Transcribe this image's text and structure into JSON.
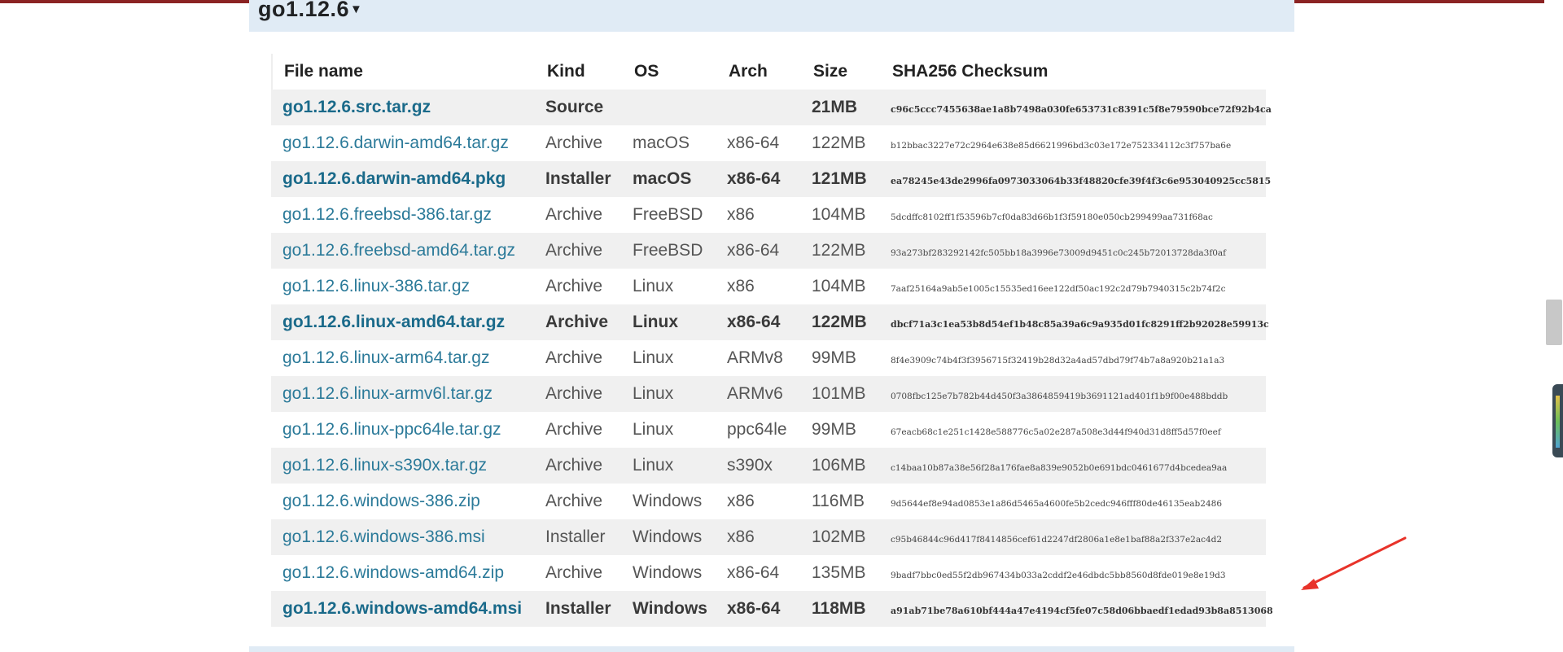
{
  "release": {
    "title": "go1.12.6",
    "caret": "▼"
  },
  "table": {
    "headers": {
      "file_name": "File name",
      "kind": "Kind",
      "os": "OS",
      "arch": "Arch",
      "size": "Size",
      "checksum": "SHA256 Checksum"
    },
    "rows": [
      {
        "file": "go1.12.6.src.tar.gz",
        "kind": "Source",
        "os": "",
        "arch": "",
        "size": "21MB",
        "sha": "c96c5ccc7455638ae1a8b7498a030fe653731c8391c5f8e79590bce72f92b4ca",
        "highlight": true
      },
      {
        "file": "go1.12.6.darwin-amd64.tar.gz",
        "kind": "Archive",
        "os": "macOS",
        "arch": "x86-64",
        "size": "122MB",
        "sha": "b12bbac3227e72c2964e638e85d6621996bd3c03e172e752334112c3f757ba6e",
        "highlight": false
      },
      {
        "file": "go1.12.6.darwin-amd64.pkg",
        "kind": "Installer",
        "os": "macOS",
        "arch": "x86-64",
        "size": "121MB",
        "sha": "ea78245e43de2996fa0973033064b33f48820cfe39f4f3c6e953040925cc5815",
        "highlight": true
      },
      {
        "file": "go1.12.6.freebsd-386.tar.gz",
        "kind": "Archive",
        "os": "FreeBSD",
        "arch": "x86",
        "size": "104MB",
        "sha": "5dcdffc8102ff1f53596b7cf0da83d66b1f3f59180e050cb299499aa731f68ac",
        "highlight": false
      },
      {
        "file": "go1.12.6.freebsd-amd64.tar.gz",
        "kind": "Archive",
        "os": "FreeBSD",
        "arch": "x86-64",
        "size": "122MB",
        "sha": "93a273bf283292142fc505bb18a3996e73009d9451c0c245b72013728da3f0af",
        "highlight": false
      },
      {
        "file": "go1.12.6.linux-386.tar.gz",
        "kind": "Archive",
        "os": "Linux",
        "arch": "x86",
        "size": "104MB",
        "sha": "7aaf25164a9ab5e1005c15535ed16ee122df50ac192c2d79b7940315c2b74f2c",
        "highlight": false
      },
      {
        "file": "go1.12.6.linux-amd64.tar.gz",
        "kind": "Archive",
        "os": "Linux",
        "arch": "x86-64",
        "size": "122MB",
        "sha": "dbcf71a3c1ea53b8d54ef1b48c85a39a6c9a935d01fc8291ff2b92028e59913c",
        "highlight": true
      },
      {
        "file": "go1.12.6.linux-arm64.tar.gz",
        "kind": "Archive",
        "os": "Linux",
        "arch": "ARMv8",
        "size": "99MB",
        "sha": "8f4e3909c74b4f3f3956715f32419b28d32a4ad57dbd79f74b7a8a920b21a1a3",
        "highlight": false
      },
      {
        "file": "go1.12.6.linux-armv6l.tar.gz",
        "kind": "Archive",
        "os": "Linux",
        "arch": "ARMv6",
        "size": "101MB",
        "sha": "0708fbc125e7b782b44d450f3a3864859419b3691121ad401f1b9f00e488bddb",
        "highlight": false
      },
      {
        "file": "go1.12.6.linux-ppc64le.tar.gz",
        "kind": "Archive",
        "os": "Linux",
        "arch": "ppc64le",
        "size": "99MB",
        "sha": "67eacb68c1e251c1428e588776c5a02e287a508e3d44f940d31d8ff5d57f0eef",
        "highlight": false
      },
      {
        "file": "go1.12.6.linux-s390x.tar.gz",
        "kind": "Archive",
        "os": "Linux",
        "arch": "s390x",
        "size": "106MB",
        "sha": "c14baa10b87a38e56f28a176fae8a839e9052b0e691bdc0461677d4bcedea9aa",
        "highlight": false
      },
      {
        "file": "go1.12.6.windows-386.zip",
        "kind": "Archive",
        "os": "Windows",
        "arch": "x86",
        "size": "116MB",
        "sha": "9d5644ef8e94ad0853e1a86d5465a4600fe5b2cedc946fff80de46135eab2486",
        "highlight": false
      },
      {
        "file": "go1.12.6.windows-386.msi",
        "kind": "Installer",
        "os": "Windows",
        "arch": "x86",
        "size": "102MB",
        "sha": "c95b46844c96d417f8414856cef61d2247df2806a1e8e1baf88a2f337e2ac4d2",
        "highlight": false
      },
      {
        "file": "go1.12.6.windows-amd64.zip",
        "kind": "Archive",
        "os": "Windows",
        "arch": "x86-64",
        "size": "135MB",
        "sha": "9badf7bbc0ed55f2db967434b033a2cddf2e46dbdc5bb8560d8fde019e8e19d3",
        "highlight": false
      },
      {
        "file": "go1.12.6.windows-amd64.msi",
        "kind": "Installer",
        "os": "Windows",
        "arch": "x86-64",
        "size": "118MB",
        "sha": "a91ab71be78a610bf444a47e4194cf5fe07c58d06bbaedf1edad93b8a8513068",
        "highlight": true
      }
    ]
  },
  "annotation": {
    "arrow_color": "#e8332a"
  }
}
